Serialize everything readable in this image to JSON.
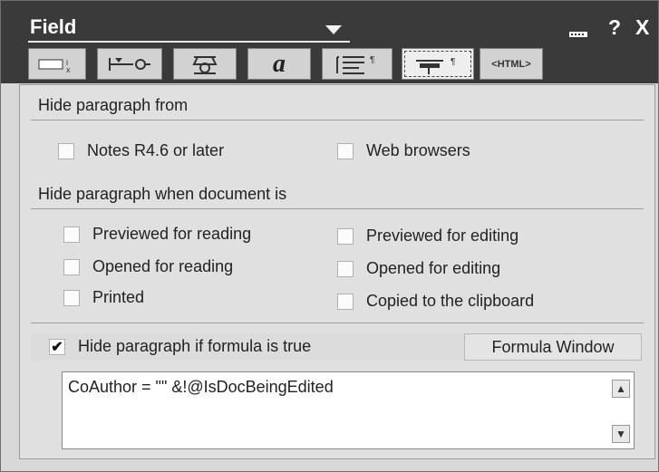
{
  "window": {
    "title": "Field",
    "help_label": "?",
    "close_label": "X"
  },
  "tabs": [
    {
      "name": "tab-field-info",
      "icon": "field-info-icon"
    },
    {
      "name": "tab-field-options",
      "icon": "field-options-icon"
    },
    {
      "name": "tab-paragraph-alignment",
      "icon": "paragraph-alignment-icon"
    },
    {
      "name": "tab-font",
      "icon": "font-icon",
      "glyph": "a"
    },
    {
      "name": "tab-paragraph-spacing",
      "icon": "paragraph-spacing-icon"
    },
    {
      "name": "tab-hide-when",
      "icon": "hide-when-icon",
      "active": true
    },
    {
      "name": "tab-html",
      "icon": "html-icon",
      "label": "<HTML>"
    }
  ],
  "hide_from": {
    "label": "Hide paragraph from",
    "options": [
      {
        "label": "Notes R4.6 or later",
        "checked": false
      },
      {
        "label": "Web browsers",
        "checked": false
      }
    ]
  },
  "hide_when": {
    "label": "Hide paragraph when document is",
    "options": [
      {
        "label": "Previewed for reading",
        "checked": false
      },
      {
        "label": "Previewed for editing",
        "checked": false
      },
      {
        "label": "Opened for reading",
        "checked": false
      },
      {
        "label": "Opened for editing",
        "checked": false
      },
      {
        "label": "Printed",
        "checked": false
      },
      {
        "label": "Copied to the clipboard",
        "checked": false
      }
    ]
  },
  "formula": {
    "checkbox_label": "Hide paragraph if formula is true",
    "checked": true,
    "window_button": "Formula Window",
    "text": "CoAuthor = \"\" &!@IsDocBeingEdited"
  }
}
